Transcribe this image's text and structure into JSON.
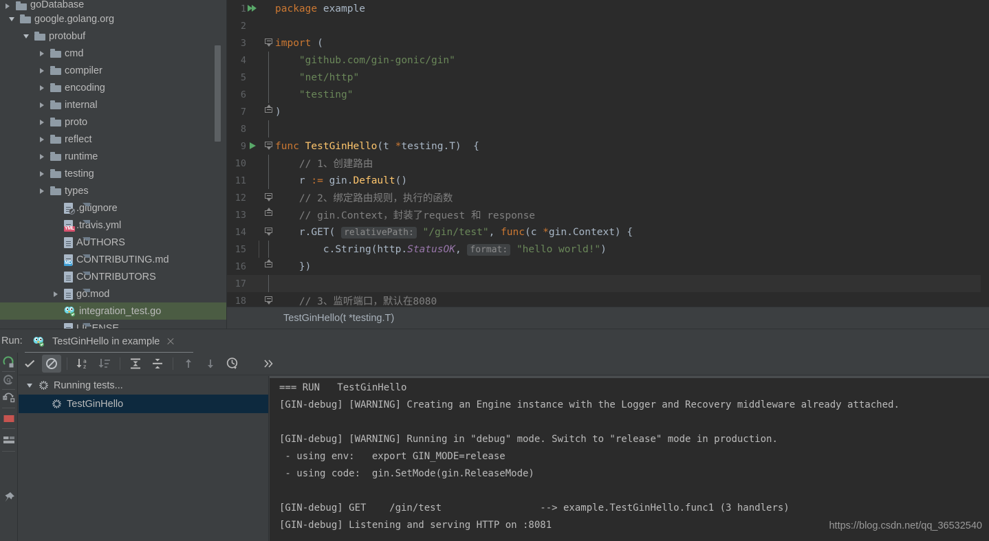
{
  "project_tree": {
    "rows": [
      {
        "label": "goDatabase",
        "indent": 18,
        "twisty": "right",
        "icon": "folder",
        "clipped": true
      },
      {
        "label": "google.golang.org",
        "indent": 24,
        "twisty": "down",
        "icon": "folder"
      },
      {
        "label": "protobuf",
        "indent": 45,
        "twisty": "down",
        "icon": "folder"
      },
      {
        "label": "cmd",
        "indent": 68,
        "twisty": "right",
        "icon": "folder"
      },
      {
        "label": "compiler",
        "indent": 68,
        "twisty": "right",
        "icon": "folder"
      },
      {
        "label": "encoding",
        "indent": 68,
        "twisty": "right",
        "icon": "folder"
      },
      {
        "label": "internal",
        "indent": 68,
        "twisty": "right",
        "icon": "folder"
      },
      {
        "label": "proto",
        "indent": 68,
        "twisty": "right",
        "icon": "folder"
      },
      {
        "label": "reflect",
        "indent": 68,
        "twisty": "right",
        "icon": "folder"
      },
      {
        "label": "runtime",
        "indent": 68,
        "twisty": "right",
        "icon": "folder"
      },
      {
        "label": "testing",
        "indent": 68,
        "twisty": "right",
        "icon": "folder"
      },
      {
        "label": "types",
        "indent": 68,
        "twisty": "right",
        "icon": "folder"
      },
      {
        "label": ".gitignore",
        "indent": 88,
        "twisty": "none",
        "icon": "file-gitignore"
      },
      {
        "label": ".travis.yml",
        "indent": 88,
        "twisty": "none",
        "icon": "file-yml"
      },
      {
        "label": "AUTHORS",
        "indent": 88,
        "twisty": "none",
        "icon": "file"
      },
      {
        "label": "CONTRIBUTING.md",
        "indent": 88,
        "twisty": "none",
        "icon": "file-md"
      },
      {
        "label": "CONTRIBUTORS",
        "indent": 88,
        "twisty": "none",
        "icon": "file"
      },
      {
        "label": "go.mod",
        "indent": 88,
        "twisty": "right",
        "icon": "file"
      },
      {
        "label": "integration_test.go",
        "indent": 88,
        "twisty": "none",
        "icon": "go",
        "selected": true
      },
      {
        "label": "LICENSE",
        "indent": 88,
        "twisty": "none",
        "icon": "file"
      }
    ]
  },
  "editor": {
    "lines": [
      {
        "num": "1",
        "gutter": "run-double",
        "fold": "none",
        "indent_guide": false,
        "tokens": [
          {
            "t": "package ",
            "c": "kw"
          },
          {
            "t": "example",
            "c": "pl"
          }
        ]
      },
      {
        "num": "2",
        "gutter": "none",
        "fold": "none",
        "indent_guide": false,
        "tokens": []
      },
      {
        "num": "3",
        "gutter": "none",
        "fold": "start",
        "indent_guide": false,
        "tokens": [
          {
            "t": "import",
            "c": "kw"
          },
          {
            "t": " (",
            "c": "pl"
          }
        ]
      },
      {
        "num": "4",
        "gutter": "none",
        "fold": "none",
        "indent_guide": false,
        "tokens": [
          {
            "t": "    \"github.com/gin-gonic/gin\"",
            "c": "str"
          }
        ]
      },
      {
        "num": "5",
        "gutter": "none",
        "fold": "none",
        "indent_guide": false,
        "tokens": [
          {
            "t": "    \"net/http\"",
            "c": "str"
          }
        ]
      },
      {
        "num": "6",
        "gutter": "none",
        "fold": "none",
        "indent_guide": false,
        "tokens": [
          {
            "t": "    \"testing\"",
            "c": "str"
          }
        ]
      },
      {
        "num": "7",
        "gutter": "none",
        "fold": "end",
        "indent_guide": false,
        "tokens": [
          {
            "t": ")",
            "c": "pl"
          }
        ]
      },
      {
        "num": "8",
        "gutter": "none",
        "fold": "none",
        "indent_guide": false,
        "tokens": []
      },
      {
        "num": "9",
        "gutter": "run-single",
        "fold": "start",
        "indent_guide": false,
        "tokens": [
          {
            "t": "func ",
            "c": "kw"
          },
          {
            "t": "TestGinHello",
            "c": "fn"
          },
          {
            "t": "(t ",
            "c": "pl"
          },
          {
            "t": "*",
            "c": "kw"
          },
          {
            "t": "testing.T)  {",
            "c": "pl"
          }
        ]
      },
      {
        "num": "10",
        "gutter": "none",
        "fold": "none",
        "indent_guide": false,
        "tokens": [
          {
            "t": "    // 1、创建路由",
            "c": "cmt"
          }
        ]
      },
      {
        "num": "11",
        "gutter": "none",
        "fold": "none",
        "indent_guide": false,
        "tokens": [
          {
            "t": "    r ",
            "c": "pl"
          },
          {
            "t": ":=",
            "c": "kw"
          },
          {
            "t": " gin.",
            "c": "pl"
          },
          {
            "t": "Default",
            "c": "fn"
          },
          {
            "t": "()",
            "c": "pl"
          }
        ]
      },
      {
        "num": "12",
        "gutter": "none",
        "fold": "start",
        "indent_guide": false,
        "tokens": [
          {
            "t": "    // 2、绑定路由规则，执行的函数",
            "c": "cmt"
          }
        ]
      },
      {
        "num": "13",
        "gutter": "none",
        "fold": "end",
        "indent_guide": false,
        "tokens": [
          {
            "t": "    // gin.Context，封装了request 和 response",
            "c": "cmt"
          }
        ]
      },
      {
        "num": "14",
        "gutter": "none",
        "fold": "start",
        "indent_guide": false,
        "tokens": [
          {
            "t": "    r.",
            "c": "pl"
          },
          {
            "t": "GET",
            "c": "pl"
          },
          {
            "t": "( ",
            "c": "pl"
          },
          {
            "t": "relativePath:",
            "c": "hint"
          },
          {
            "t": " ",
            "c": "pl"
          },
          {
            "t": "\"/gin/test\"",
            "c": "str"
          },
          {
            "t": ", ",
            "c": "pl"
          },
          {
            "t": "func",
            "c": "kw"
          },
          {
            "t": "(c ",
            "c": "pl"
          },
          {
            "t": "*",
            "c": "kw"
          },
          {
            "t": "gin.Context) {",
            "c": "pl"
          }
        ]
      },
      {
        "num": "15",
        "gutter": "none",
        "fold": "none",
        "indent_guide": true,
        "tokens": [
          {
            "t": "        c.",
            "c": "pl"
          },
          {
            "t": "String",
            "c": "pl"
          },
          {
            "t": "(http.",
            "c": "pl"
          },
          {
            "t": "StatusOK",
            "c": "pkg ital"
          },
          {
            "t": ", ",
            "c": "pl"
          },
          {
            "t": "format:",
            "c": "hint"
          },
          {
            "t": " ",
            "c": "pl"
          },
          {
            "t": "\"hello world!\"",
            "c": "str"
          },
          {
            "t": ")",
            "c": "pl"
          }
        ]
      },
      {
        "num": "16",
        "gutter": "none",
        "fold": "end",
        "indent_guide": false,
        "tokens": [
          {
            "t": "    })",
            "c": "pl"
          }
        ]
      },
      {
        "num": "17",
        "gutter": "none",
        "fold": "none",
        "indent_guide": false,
        "current": true,
        "tokens": []
      },
      {
        "num": "18",
        "gutter": "none",
        "fold": "start",
        "indent_guide": false,
        "tokens": [
          {
            "t": "    // 3、监听端口，默认在8080",
            "c": "cmt"
          }
        ]
      }
    ]
  },
  "breadcrumb": {
    "text": "TestGinHello(t *testing.T)"
  },
  "run_panel": {
    "run_label": "Run:",
    "tab_title": "TestGinHello in example",
    "toolbar": [
      {
        "name": "show-passed-button",
        "icon": "check",
        "pressed": false
      },
      {
        "name": "hide-ignored-button",
        "icon": "circle-slash",
        "pressed": true
      },
      {
        "sep": true
      },
      {
        "name": "sort-alphabetically-button",
        "icon": "sort-az",
        "pressed": false
      },
      {
        "name": "sort-by-duration-button",
        "icon": "sort-duration",
        "pressed": false
      },
      {
        "sep": true
      },
      {
        "name": "expand-all-button",
        "icon": "expand-all",
        "pressed": false
      },
      {
        "name": "collapse-all-button",
        "icon": "collapse-all",
        "pressed": false
      },
      {
        "sep": true
      },
      {
        "name": "previous-failed-button",
        "icon": "arrow-up",
        "pressed": false
      },
      {
        "name": "next-failed-button",
        "icon": "arrow-down",
        "pressed": false
      },
      {
        "name": "test-history-button",
        "icon": "clock",
        "pressed": false
      },
      {
        "name": "overflow-button",
        "icon": "chevron-double-right",
        "pressed": false
      }
    ],
    "left_strip": [
      {
        "name": "rerun-button",
        "icon": "rerun-green"
      },
      {
        "name": "rerun-failed-button",
        "icon": "rerun-failed"
      },
      {
        "name": "toggle-auto-test-button",
        "icon": "auto-test"
      },
      {
        "name": "stop-button",
        "icon": "stop-red"
      },
      {
        "name": "layout-button",
        "icon": "layout"
      },
      {
        "name": "pin-tab-button",
        "icon": "pin"
      }
    ],
    "test_tree": [
      {
        "label": "Running tests...",
        "indent": 10,
        "twisty": "down",
        "icon": "spinner",
        "selected": false
      },
      {
        "label": "TestGinHello",
        "indent": 48,
        "twisty": "none",
        "icon": "spinner",
        "selected": true
      }
    ],
    "console_lines": [
      "=== RUN   TestGinHello",
      "[GIN-debug] [WARNING] Creating an Engine instance with the Logger and Recovery middleware already attached.",
      "",
      "[GIN-debug] [WARNING] Running in \"debug\" mode. Switch to \"release\" mode in production.",
      " - using env:   export GIN_MODE=release",
      " - using code:  gin.SetMode(gin.ReleaseMode)",
      "",
      "[GIN-debug] GET    /gin/test                 --> example.TestGinHello.func1 (3 handlers)",
      "[GIN-debug] Listening and serving HTTP on :8081"
    ]
  },
  "watermark": {
    "text": "https://blog.csdn.net/qq_36532540"
  },
  "colors": {
    "panel_bg": "#3c3f41",
    "editor_bg": "#2b2b2b",
    "current_line": "#323232",
    "tree_selection": "#4b5c43",
    "test_selection": "#0d293e",
    "keyword": "#cc7832",
    "string": "#6a8759",
    "function": "#ffc66d",
    "comment": "#808080",
    "plain": "#a9b7c6",
    "field": "#9876aa",
    "run_green": "#59a869",
    "stop_red": "#c75450"
  }
}
